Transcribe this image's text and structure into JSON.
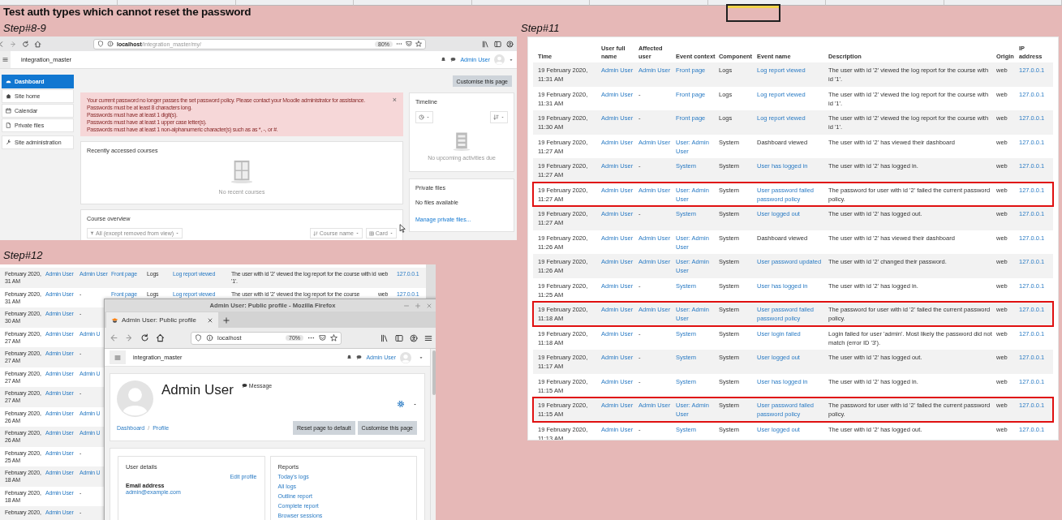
{
  "sheet": {
    "title": "Test auth types which cannot reset the password"
  },
  "dashboard_shot": {
    "caption": "Step#8-9",
    "url": "**localhost**/integration_master/my/",
    "zoom": "80%",
    "site_name": "integration_master",
    "user_name": "Admin User",
    "nav": [
      {
        "label": "Dashboard",
        "selected": true
      },
      {
        "label": "Site home",
        "selected": false
      },
      {
        "label": "Calendar",
        "selected": false
      },
      {
        "label": "Private files",
        "selected": false
      }
    ],
    "admin_nav": [
      {
        "label": "Site administration",
        "selected": false
      }
    ],
    "customise_button": "Customise this page",
    "alert": {
      "lines": [
        "Your current password no longer passes the set password policy. Please contact your Moodle administrator for assistance.",
        "Passwords must be at least 8 characters long.",
        "Passwords must have at least 1 digit(s).",
        "Passwords must have at least 1 upper case letter(s).",
        "Passwords must have at least 1 non-alphanumeric character(s) such as as *, -, or #."
      ],
      "close": "×"
    },
    "recent_courses": {
      "title": "Recently accessed courses",
      "empty": "No recent courses"
    },
    "course_overview": {
      "title": "Course overview",
      "filter": "All (except removed from view)",
      "sort": "Course name",
      "view": "Card"
    },
    "timeline": {
      "title": "Timeline",
      "empty": "No upcoming activities due"
    },
    "private_files": {
      "title": "Private files",
      "empty": "No files available",
      "link": "Manage private files..."
    }
  },
  "profile_shot": {
    "caption": "Step#12",
    "log_rows": [
      {
        "time": "February 2020, 31 AM",
        "user": "Admin User",
        "affected": "Admin User",
        "context": "Front page",
        "component": "Logs",
        "event": "Log report viewed",
        "description": "The user with id '2' viewed the log report for the course with id '1'.",
        "origin": "web",
        "ip": "127.0.0.1"
      },
      {
        "time": "February 2020, 31 AM",
        "user": "Admin User",
        "affected": "-",
        "context": "Front page",
        "component": "Logs",
        "event": "Log report viewed",
        "description": "The user with id '2' viewed the log report for the course",
        "origin": "web",
        "ip": "127.0.0.1"
      },
      {
        "time": "February 2020, 30 AM",
        "user": "Admin User",
        "affected": "-"
      },
      {
        "time": "February 2020, 27 AM",
        "user": "Admin User",
        "affected": "Admin U"
      },
      {
        "time": "February 2020, 27 AM",
        "user": "Admin User",
        "affected": "-"
      },
      {
        "time": "February 2020, 27 AM",
        "user": "Admin User",
        "affected": "Admin U"
      },
      {
        "time": "February 2020, 27 AM",
        "user": "Admin User",
        "affected": "-"
      },
      {
        "time": "February 2020, 26 AM",
        "user": "Admin User",
        "affected": "Admin U"
      },
      {
        "time": "February 2020, 26 AM",
        "user": "Admin User",
        "affected": "Admin U"
      },
      {
        "time": "February 2020, 25 AM",
        "user": "Admin User",
        "affected": "-"
      },
      {
        "time": "February 2020, 18 AM",
        "user": "Admin User",
        "affected": "Admin U"
      },
      {
        "time": "February 2020, 18 AM",
        "user": "Admin User",
        "affected": "-"
      },
      {
        "time": "February 2020,",
        "user": "Admin User",
        "affected": "-"
      }
    ],
    "window": {
      "title": "Admin User: Public profile - Mozilla Firefox",
      "tab": "Admin User: Public profile",
      "url": "localhost",
      "zoom": "70%",
      "site_name": "integration_master",
      "user_name": "Admin User",
      "profile_name": "Admin User",
      "message": "Message",
      "breadcrumbs": [
        "Dashboard",
        "Profile"
      ],
      "breadcrumb_separator": "/",
      "buttons": [
        "Reset page to default",
        "Customise this page"
      ],
      "user_details": {
        "title": "User details",
        "edit": "Edit profile",
        "email_label": "Email address",
        "email": "admin@example.com"
      },
      "reports": {
        "title": "Reports",
        "links": [
          "Today's logs",
          "All logs",
          "Outline report",
          "Complete report",
          "Browser sessions"
        ]
      }
    }
  },
  "log_shot": {
    "caption": "Step#11",
    "columns": [
      "Time",
      "User full name",
      "Affected user",
      "Event context",
      "Component",
      "Event name",
      "Description",
      "Origin",
      "IP address"
    ],
    "rows": [
      {
        "time": "19 February 2020, 11:31 AM",
        "user": "Admin User",
        "affected": "Admin User",
        "context": "Front page",
        "component": "Logs",
        "event": "Log report viewed",
        "event_link": true,
        "description": "The user with id '2' viewed the log report for the course with id '1'.",
        "origin": "web",
        "ip": "127.0.0.1",
        "flagged": false
      },
      {
        "time": "19 February 2020, 11:31 AM",
        "user": "Admin User",
        "affected": "-",
        "context": "Front page",
        "component": "Logs",
        "event": "Log report viewed",
        "event_link": true,
        "description": "The user with id '2' viewed the log report for the course with id '1'.",
        "origin": "web",
        "ip": "127.0.0.1",
        "flagged": false
      },
      {
        "time": "19 February 2020, 11:30 AM",
        "user": "Admin User",
        "affected": "-",
        "context": "Front page",
        "component": "Logs",
        "event": "Log report viewed",
        "event_link": true,
        "description": "The user with id '2' viewed the log report for the course with id '1'.",
        "origin": "web",
        "ip": "127.0.0.1",
        "flagged": false
      },
      {
        "time": "19 February 2020, 11:27 AM",
        "user": "Admin User",
        "affected": "Admin User",
        "context": "User: Admin User",
        "component": "System",
        "event": "Dashboard viewed",
        "event_link": false,
        "description": "The user with id '2' has viewed their dashboard",
        "origin": "web",
        "ip": "127.0.0.1",
        "flagged": false
      },
      {
        "time": "19 February 2020, 11:27 AM",
        "user": "Admin User",
        "affected": "-",
        "context": "System",
        "component": "System",
        "event": "User has logged in",
        "event_link": true,
        "description": "The user with id '2' has logged in.",
        "origin": "web",
        "ip": "127.0.0.1",
        "flagged": false
      },
      {
        "time": "19 February 2020, 11:27 AM",
        "user": "Admin User",
        "affected": "Admin User",
        "context": "User: Admin User",
        "component": "System",
        "event": "User password failed password policy",
        "event_link": true,
        "description": "The password for user with id '2' failed the current password policy.",
        "origin": "web",
        "ip": "127.0.0.1",
        "flagged": true
      },
      {
        "time": "19 February 2020, 11:27 AM",
        "user": "Admin User",
        "affected": "-",
        "context": "System",
        "component": "System",
        "event": "User logged out",
        "event_link": true,
        "description": "The user with id '2' has logged out.",
        "origin": "web",
        "ip": "127.0.0.1",
        "flagged": false
      },
      {
        "time": "19 February 2020, 11:26 AM",
        "user": "Admin User",
        "affected": "Admin User",
        "context": "User: Admin User",
        "component": "System",
        "event": "Dashboard viewed",
        "event_link": false,
        "description": "The user with id '2' has viewed their dashboard",
        "origin": "web",
        "ip": "127.0.0.1",
        "flagged": false
      },
      {
        "time": "19 February 2020, 11:26 AM",
        "user": "Admin User",
        "affected": "Admin User",
        "context": "User: Admin User",
        "component": "System",
        "event": "User password updated",
        "event_link": true,
        "description": "The user with id '2' changed their password.",
        "origin": "web",
        "ip": "127.0.0.1",
        "flagged": false
      },
      {
        "time": "19 February 2020, 11:25 AM",
        "user": "Admin User",
        "affected": "-",
        "context": "System",
        "component": "System",
        "event": "User has logged in",
        "event_link": true,
        "description": "The user with id '2' has logged in.",
        "origin": "web",
        "ip": "127.0.0.1",
        "flagged": false
      },
      {
        "time": "19 February 2020, 11:18 AM",
        "user": "Admin User",
        "affected": "Admin User",
        "context": "User: Admin User",
        "component": "System",
        "event": "User password failed password policy",
        "event_link": true,
        "description": "The password for user with id '2' failed the current password policy.",
        "origin": "web",
        "ip": "127.0.0.1",
        "flagged": true
      },
      {
        "time": "19 February 2020, 11:18 AM",
        "user": "Admin User",
        "affected": "-",
        "context": "System",
        "component": "System",
        "event": "User login failed",
        "event_link": true,
        "description": "Login failed for user 'admin'. Most likely the password did not match (error ID '3').",
        "origin": "web",
        "ip": "127.0.0.1",
        "flagged": false
      },
      {
        "time": "19 February 2020, 11:17 AM",
        "user": "Admin User",
        "affected": "-",
        "context": "System",
        "component": "System",
        "event": "User logged out",
        "event_link": true,
        "description": "The user with id '2' has logged out.",
        "origin": "web",
        "ip": "127.0.0.1",
        "flagged": false
      },
      {
        "time": "19 February 2020, 11:15 AM",
        "user": "Admin User",
        "affected": "-",
        "context": "System",
        "component": "System",
        "event": "User has logged in",
        "event_link": true,
        "description": "The user with id '2' has logged in.",
        "origin": "web",
        "ip": "127.0.0.1",
        "flagged": false
      },
      {
        "time": "19 February 2020, 11:15 AM",
        "user": "Admin User",
        "affected": "Admin User",
        "context": "User: Admin User",
        "component": "System",
        "event": "User password failed password policy",
        "event_link": true,
        "description": "The password for user with id '2' failed the current password policy.",
        "origin": "web",
        "ip": "127.0.0.1",
        "flagged": true
      },
      {
        "time": "19 February 2020, 11:13 AM",
        "user": "Admin User",
        "affected": "-",
        "context": "System",
        "component": "System",
        "event": "User logged out",
        "event_link": true,
        "description": "The user with id '2' has logged out.",
        "origin": "web",
        "ip": "127.0.0.1",
        "flagged": false
      }
    ]
  }
}
